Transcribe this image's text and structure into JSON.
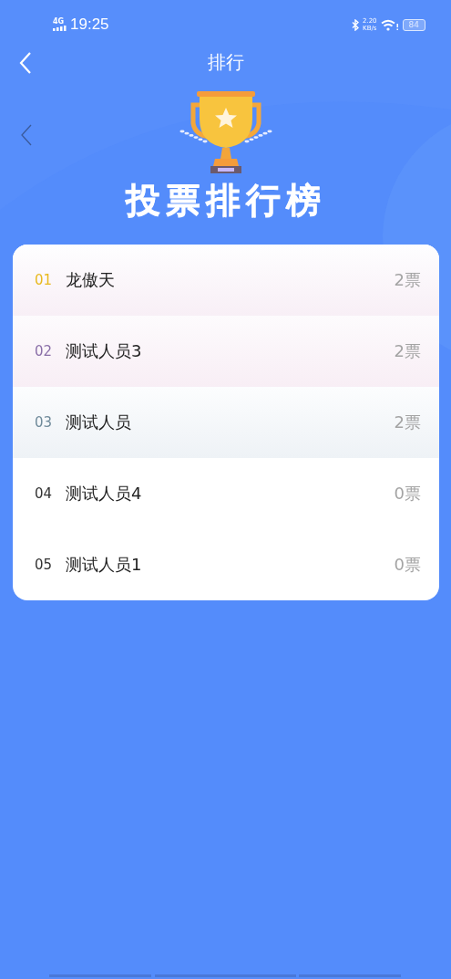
{
  "status_bar": {
    "network": "4G",
    "time": "19:25",
    "speed": "2.20",
    "speed_unit": "KB/s",
    "battery": "84"
  },
  "nav": {
    "title": "排行"
  },
  "banner": {
    "title": "投票排行榜"
  },
  "ranking": [
    {
      "rank": "01",
      "name": "龙傲天",
      "votes": "2票",
      "kind": "first",
      "color": "#e8b91e"
    },
    {
      "rank": "02",
      "name": "测试人员3",
      "votes": "2票",
      "kind": "second",
      "color": "#8a6fa8"
    },
    {
      "rank": "03",
      "name": "测试人员",
      "votes": "2票",
      "kind": "third",
      "color": "#6f8a9a"
    },
    {
      "rank": "04",
      "name": "测试人员4",
      "votes": "0票",
      "kind": "normal",
      "color": "#333333"
    },
    {
      "rank": "05",
      "name": "测试人员1",
      "votes": "0票",
      "kind": "normal",
      "color": "#333333"
    }
  ]
}
